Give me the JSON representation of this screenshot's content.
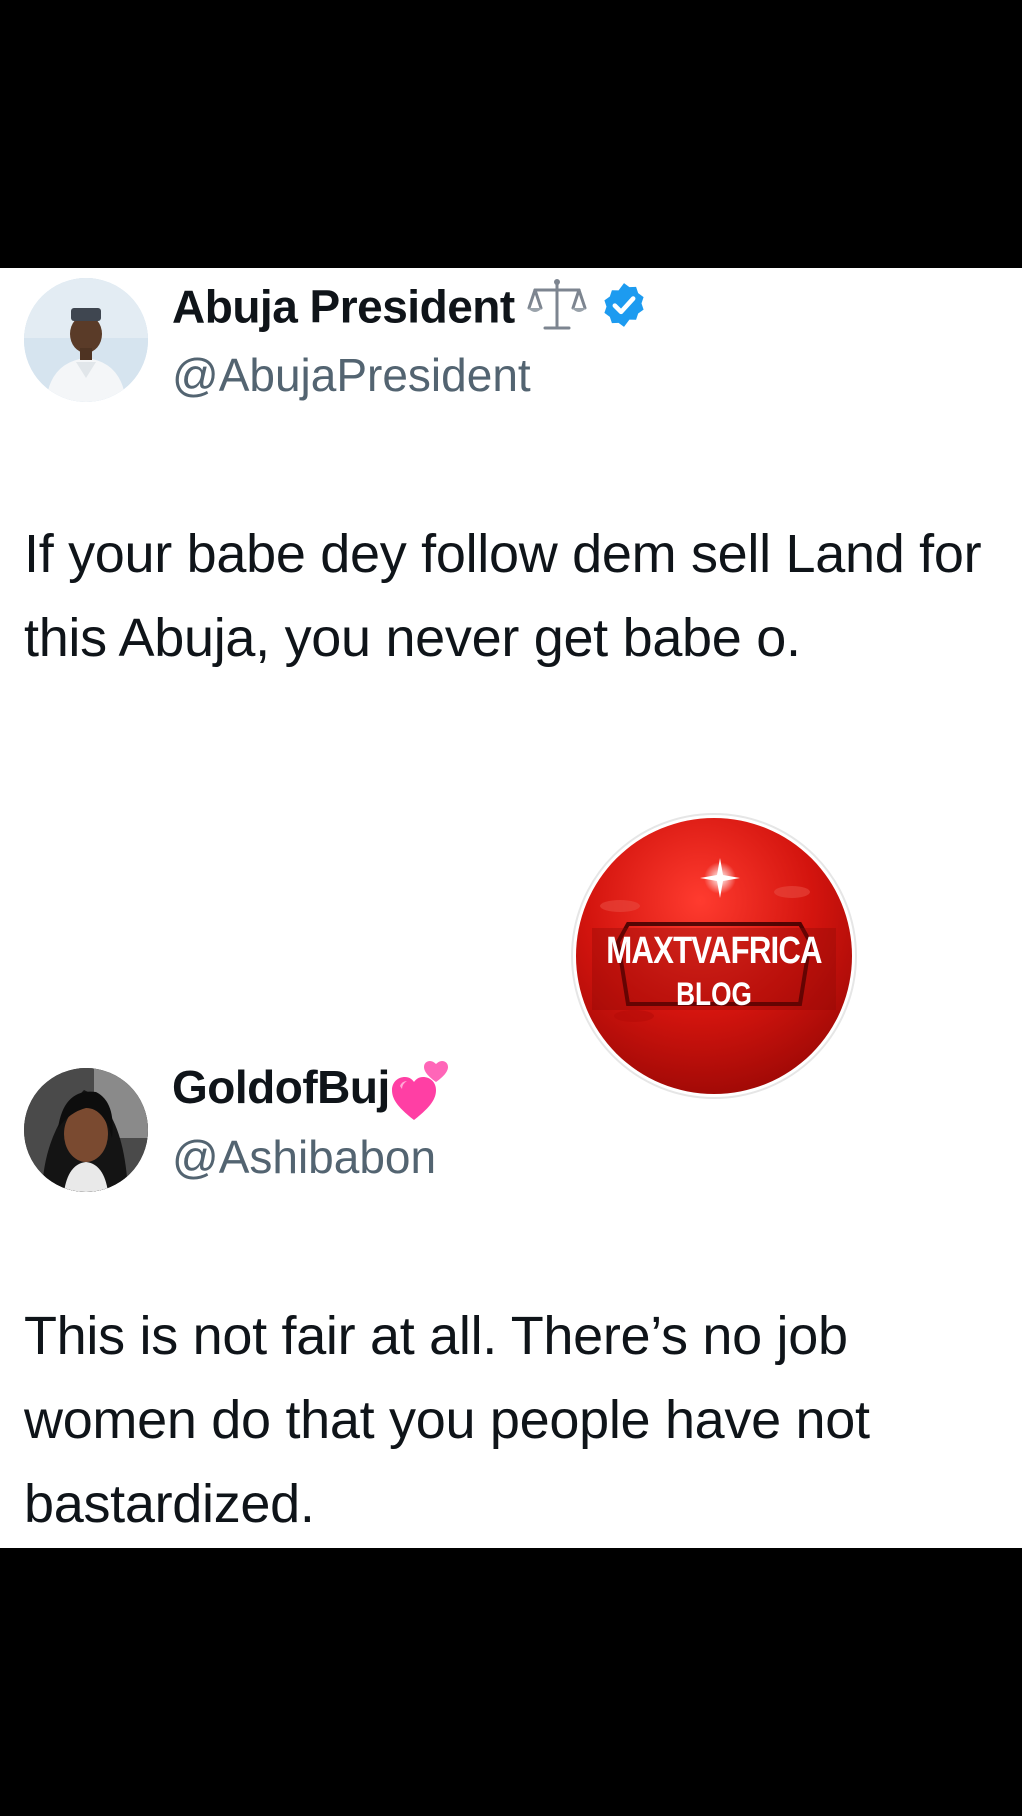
{
  "tweets": [
    {
      "display_name": "Abuja President",
      "handle": "@AbujaPresident",
      "name_emoji_icon": "balance-scale-icon",
      "verified_icon": "verified-badge-icon",
      "text": "If your babe dey follow dem sell Land for this Abuja, you never get babe o."
    },
    {
      "display_name": "GoldofBuj",
      "handle": "@Ashibabon",
      "name_emoji_icon": "two-hearts-icon",
      "text": "This is not fair at all. There’s no job women do that you people have not bastardized."
    }
  ],
  "watermark": {
    "line1": "MAXTVAFRICA",
    "line2": "BLOG"
  },
  "colors": {
    "name": "#0f1419",
    "handle": "#536471",
    "verified": "#1d9bf0",
    "watermark_red": "#c8100c",
    "background": "#ffffff",
    "frame": "#000000"
  }
}
